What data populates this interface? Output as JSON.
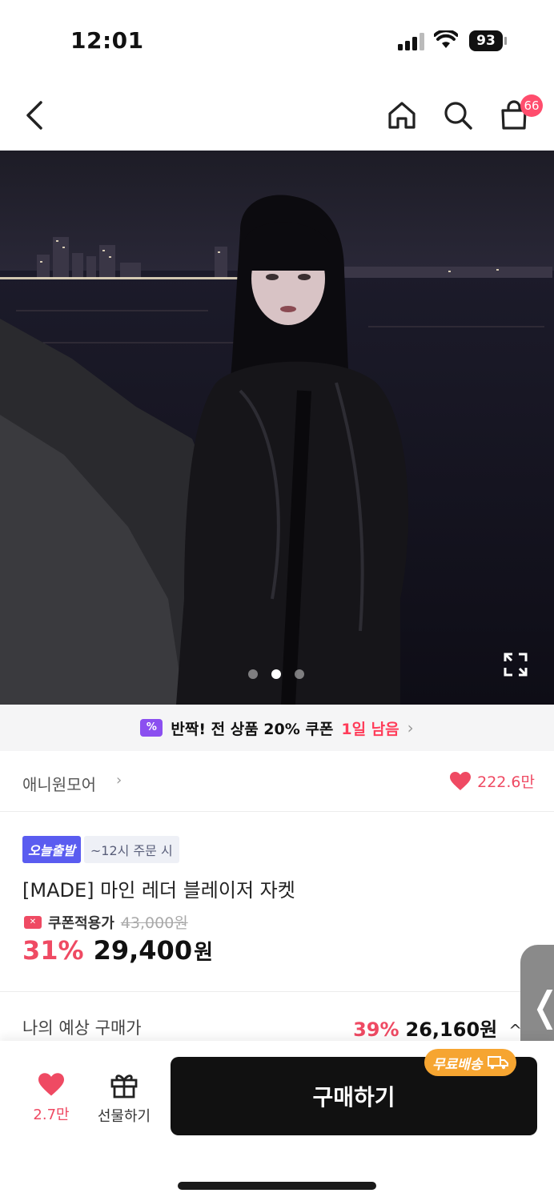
{
  "status_bar": {
    "time": "12:01",
    "battery": "93"
  },
  "nav": {
    "cart_count": "66",
    "icons": [
      "chevron-left-icon",
      "home-icon",
      "search-icon",
      "shopping-bag-icon"
    ]
  },
  "gallery": {
    "page_count": 3,
    "active_page": 2
  },
  "coupon_banner": {
    "text": "반짝! 전 상품 20% 쿠폰",
    "remaining": "1일 남음",
    "chevron": "›",
    "icon_glyph": "%"
  },
  "brand": {
    "name": "애니원모어",
    "chevron": "›",
    "likes": "222.6만"
  },
  "product": {
    "tag_today": "오늘출발",
    "tag_order": "~12시 주문 시",
    "title": "[MADE] 마인 레더 블레이저 자켓",
    "coupon_label": "쿠폰적용가",
    "original_price": "43,000원",
    "discount": "31%",
    "price": "29,400",
    "price_unit": "원"
  },
  "expected": {
    "label": "나의 예상 구매가",
    "discount": "39%",
    "price": "26,160원",
    "chevron": "^"
  },
  "side_tab": {
    "glyph": "❬"
  },
  "bottom": {
    "wish_count": "2.7만",
    "gift_label": "선물하기",
    "buy_label": "구매하기",
    "free_shipping": "무료배송"
  },
  "colors": {
    "accent_pink": "#ef4a63",
    "badge_red": "#ff4d6d",
    "purple": "#8b4ff0",
    "today_blue": "#5a5cf0",
    "shipping_orange": "#f6a531"
  }
}
